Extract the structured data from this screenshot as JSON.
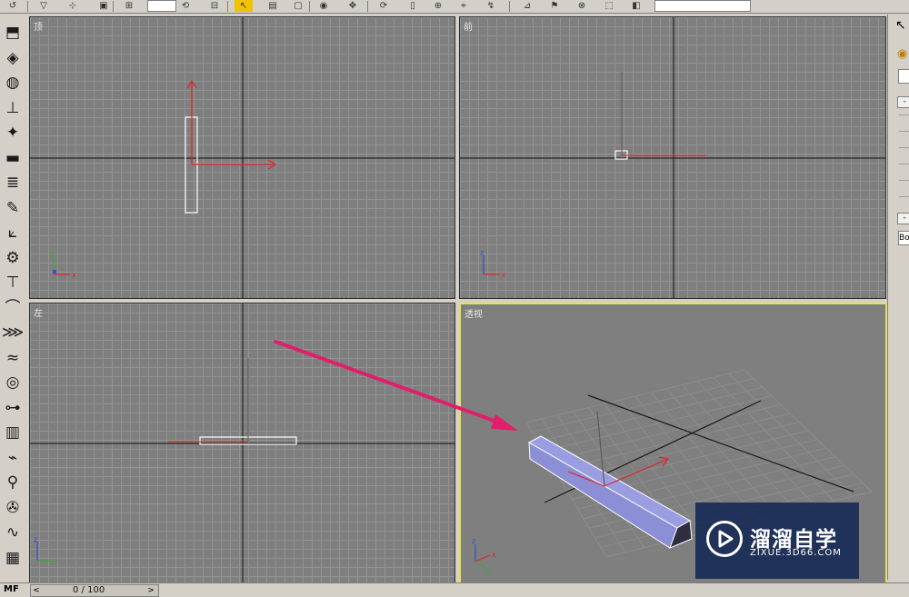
{
  "toolbar": {
    "buttons": [
      "↺",
      "▽",
      "⊹",
      "▣",
      "⊞",
      "⧉",
      "⟲",
      "⊟",
      "↖",
      "▤",
      "▢",
      "◉",
      "✥",
      "⟳",
      "▯",
      "⊕",
      "⌖",
      "↯",
      "⊿",
      "⚑",
      "⊗",
      "⬚",
      "◧",
      "✓",
      "⚲",
      "☷"
    ],
    "field_text": "",
    "colors": {
      "accent": "#f0c200"
    }
  },
  "left_tools": [
    "⬒",
    "◈",
    "◍",
    "⊥",
    "✦",
    "▬",
    "≣",
    "✎",
    "⟀",
    "⚙",
    "⊤",
    "⌒",
    "⋙",
    "≈",
    "◎",
    "⊶",
    "▥",
    "⌁",
    "⚲",
    "✇",
    "∿",
    "▦"
  ],
  "viewports": {
    "top": {
      "label": "顶"
    },
    "front": {
      "label": "前"
    },
    "left": {
      "label": "左"
    },
    "perspective": {
      "label": "透视",
      "active": true
    }
  },
  "axis_labels": {
    "x": "x",
    "y": "y",
    "z": "z"
  },
  "right_panel": {
    "field1": "",
    "field2": "Bo",
    "rollout_symbol": "-"
  },
  "time_slider": {
    "text": "0 / 100",
    "prev": "<",
    "next": ">"
  },
  "bottom": {
    "corner_label": "MF"
  },
  "watermark": {
    "title": "溜溜自学",
    "subtitle": "ZIXUE.3D66.COM"
  },
  "colors": {
    "viewport_bg": "#7f7f7f",
    "grid_line": "#939393",
    "active_border": "#e8e255",
    "gizmo": "#d9282b",
    "box_face": "#8b8fd6",
    "annotation_arrow": "#e01f6a"
  }
}
